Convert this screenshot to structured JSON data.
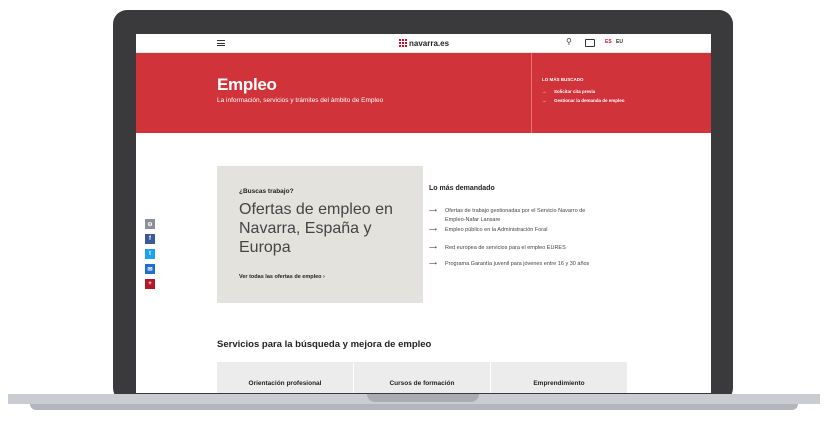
{
  "topbar": {
    "logo_text": "navarra.es",
    "search_icon": "⚲",
    "lang_es": "ES",
    "lang_eu": "EU"
  },
  "hero": {
    "title": "Empleo",
    "subtitle": "La información, servicios y trámites del ámbito de Empleo",
    "side_title": "LO MÁS BUSCADO",
    "links": [
      {
        "arrow": "→",
        "label": "Solicitar cita previa"
      },
      {
        "arrow": "→",
        "label": "Gestionar la demanda de empleo"
      }
    ]
  },
  "share": {
    "items": [
      {
        "glyph": "⊖",
        "color": "#8a8f98"
      },
      {
        "glyph": "f",
        "color": "#3b5998"
      },
      {
        "glyph": "t",
        "color": "#1da1f2"
      },
      {
        "glyph": "✉",
        "color": "#1f6fd0"
      },
      {
        "glyph": "+",
        "color": "#b5172a"
      }
    ]
  },
  "card": {
    "question": "¿Buscas trabajo?",
    "headline": "Ofertas de empleo en Navarra, España y Europa",
    "link": "Ver todas las ofertas de empleo  ›"
  },
  "most_demanded": {
    "title": "Lo más demandado",
    "items": [
      {
        "arrow": "⟶",
        "label": "Ofertas de trabajo gestionadas por el Servicio Navarro de Empleo-Nafar Lansare"
      },
      {
        "arrow": "⟶",
        "label": "Empleo público en la Administración Foral"
      },
      {
        "arrow": "⟶",
        "label": "Red europea de servicios para el empleo EURES"
      },
      {
        "arrow": "⟶",
        "label": "Programa Garantía juvenil para jóvenes entre 16 y 30 años"
      }
    ]
  },
  "services": {
    "title": "Servicios para la búsqueda y mejora de empleo",
    "tiles": [
      "Orientación profesional",
      "Cursos de formación",
      "Emprendimiento"
    ]
  },
  "colors": {
    "brand_red": "#d0333a",
    "card_bg": "#e4e2dc",
    "frame": "#3a3a3c"
  }
}
